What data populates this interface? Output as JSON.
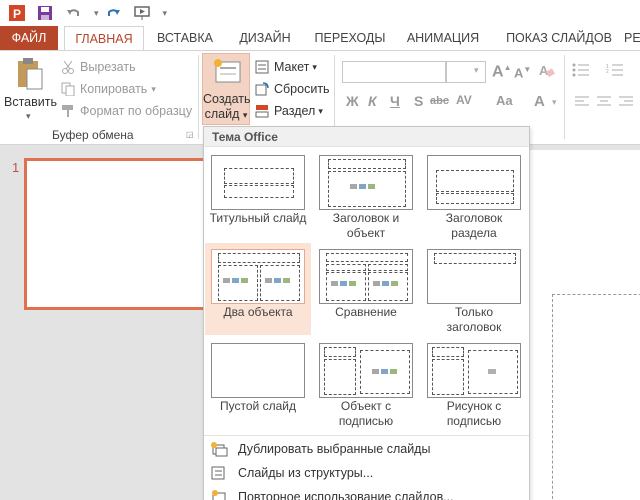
{
  "qat": {
    "icons": [
      "powerpoint-logo-icon",
      "save-icon",
      "undo-icon",
      "redo-icon",
      "from-beginning-icon",
      "customize-icon"
    ]
  },
  "tabs": {
    "file": "ФАЙЛ",
    "home": "ГЛАВНАЯ",
    "insert": "ВСТАВКА",
    "design": "ДИЗАЙН",
    "transitions": "ПЕРЕХОДЫ",
    "animations": "АНИМАЦИЯ",
    "slideshow": "ПОКАЗ СЛАЙДОВ",
    "review": "РЕЦ"
  },
  "ribbon": {
    "clipboard": {
      "paste": "Вставить",
      "cut": "Вырезать",
      "copy": "Копировать",
      "format_painter": "Формат по образцу",
      "group_label": "Буфер обмена"
    },
    "slides": {
      "new_slide_line1": "Создать",
      "new_slide_line2": "слайд",
      "layout": "Макет",
      "reset": "Сбросить",
      "section": "Раздел"
    },
    "font_glyphs": {
      "bold": "Ж",
      "italic": "К",
      "underline": "Ч",
      "shadow": "S",
      "strike": "abc",
      "spacing": "AV",
      "case": "Aa",
      "color": "A"
    }
  },
  "thumbnail": {
    "number": "1"
  },
  "dropdown": {
    "header": "Тема Office",
    "layouts": [
      {
        "label": "Титульный слайд"
      },
      {
        "label_line1": "Заголовок и",
        "label_line2": "объект"
      },
      {
        "label_line1": "Заголовок",
        "label_line2": "раздела"
      },
      {
        "label": "Два объекта"
      },
      {
        "label": "Сравнение"
      },
      {
        "label_line1": "Только",
        "label_line2": "заголовок"
      },
      {
        "label": "Пустой слайд"
      },
      {
        "label_line1": "Объект с",
        "label_line2": "подписью"
      },
      {
        "label_line1": "Рисунок с",
        "label_line2": "подписью"
      }
    ],
    "menu": {
      "duplicate": "Дублировать выбранные слайды",
      "from_outline": "Слайды из структуры...",
      "reuse": "Повторное использование слайдов..."
    }
  },
  "colors": {
    "accent": "#b7472a",
    "selection": "#fbe3d6",
    "thumb_border": "#e07150"
  }
}
